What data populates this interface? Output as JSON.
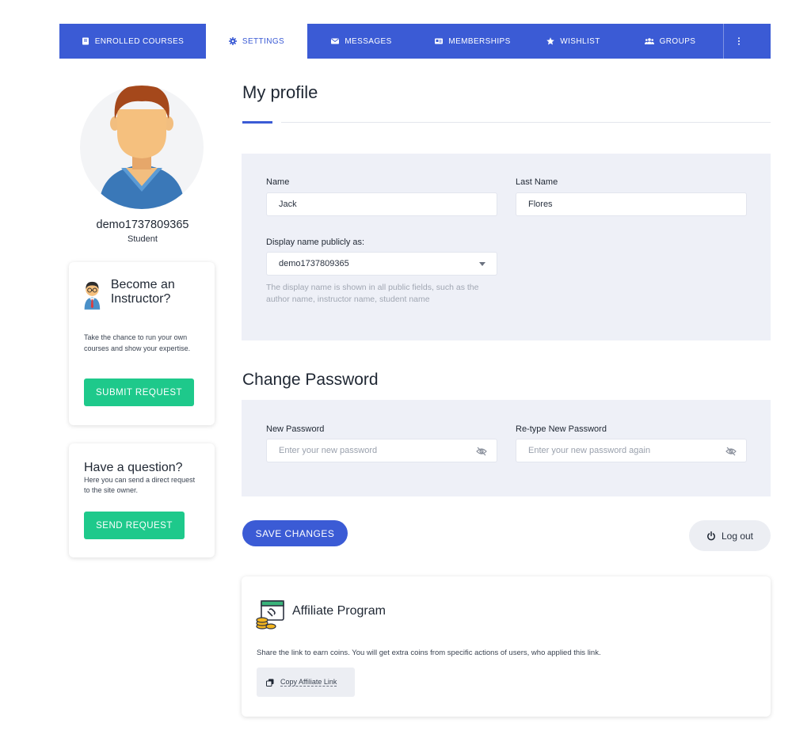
{
  "nav": {
    "tabs": [
      {
        "label": "ENROLLED COURSES",
        "icon": "book-icon"
      },
      {
        "label": "SETTINGS",
        "icon": "gear-icon"
      },
      {
        "label": "MESSAGES",
        "icon": "envelope-icon"
      },
      {
        "label": "MEMBERSHIPS",
        "icon": "id-card-icon"
      },
      {
        "label": "WISHLIST",
        "icon": "star-icon"
      },
      {
        "label": "GROUPS",
        "icon": "users-icon"
      }
    ],
    "active_tab": "SETTINGS",
    "more_icon": "vertical-dots-icon"
  },
  "user": {
    "username": "demo1737809365",
    "role": "Student"
  },
  "instructor_card": {
    "title": "Become an Instructor?",
    "description": "Take the chance to run your own courses and show your expertise.",
    "button": "SUBMIT REQUEST"
  },
  "question_card": {
    "title": "Have a question?",
    "description": "Here you can send a direct request to the site owner.",
    "button": "SEND REQUEST"
  },
  "profile": {
    "title": "My profile",
    "name_label": "Name",
    "name_value": "Jack",
    "last_name_label": "Last Name",
    "last_name_value": "Flores",
    "display_label": "Display name publicly as:",
    "display_value": "demo1737809365",
    "display_hint": "The display name is shown in all public fields, such as the author name, instructor name, student name"
  },
  "password": {
    "title": "Change Password",
    "new_label": "New Password",
    "new_placeholder": "Enter your new password",
    "retype_label": "Re-type New Password",
    "retype_placeholder": "Enter your new password again"
  },
  "actions": {
    "save": "SAVE CHANGES",
    "logout": "Log out"
  },
  "affiliate": {
    "title": "Affiliate Program",
    "description": "Share the link to earn coins. You will get extra coins from specific actions of users, who applied this link.",
    "copy_label": "Copy Affiliate Link"
  },
  "colors": {
    "primary": "#3b5bd5",
    "green": "#1ec98b",
    "panel": "#eef0f7"
  }
}
